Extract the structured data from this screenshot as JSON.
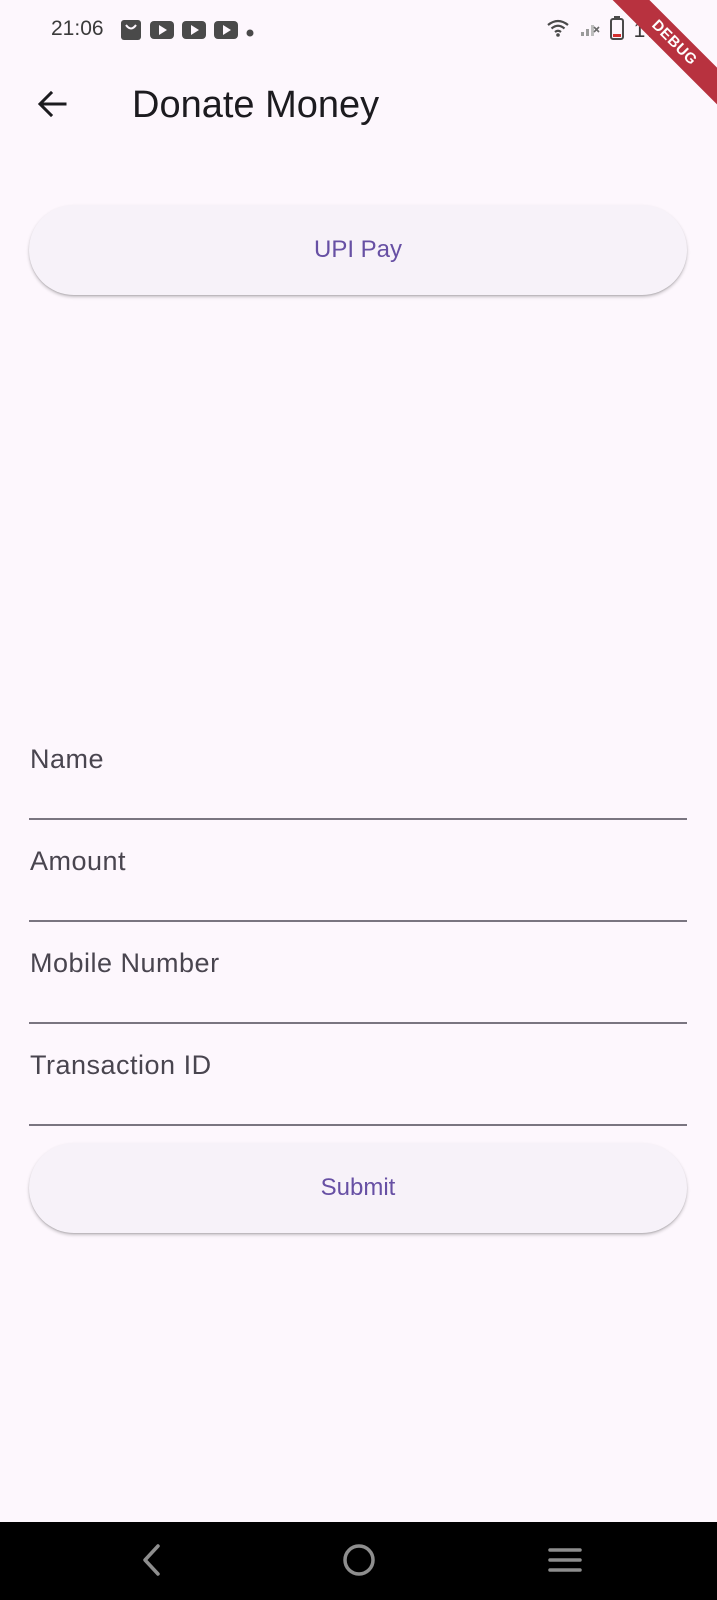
{
  "status_bar": {
    "time": "21:06",
    "battery_level": "17",
    "icons": [
      "shopping-bag-icon",
      "youtube-icon",
      "youtube-icon",
      "youtube-icon",
      "dot-icon",
      "wifi-icon",
      "signal-icon",
      "battery-icon"
    ]
  },
  "debug_banner": {
    "label": "DEBUG"
  },
  "app_bar": {
    "title": "Donate Money",
    "back_icon": "arrow-back-icon"
  },
  "upi_button": {
    "label": "UPI Pay"
  },
  "form": {
    "name": {
      "label": "Name",
      "value": ""
    },
    "amount": {
      "label": "Amount",
      "value": ""
    },
    "mobile": {
      "label": "Mobile Number",
      "value": ""
    },
    "transaction_id": {
      "label": "Transaction ID",
      "value": ""
    }
  },
  "submit_button": {
    "label": "Submit"
  },
  "nav_bar": {
    "back_icon": "nav-back-icon",
    "home_icon": "nav-home-icon",
    "recents_icon": "nav-menu-icon"
  },
  "colors": {
    "background": "#fdf7fd",
    "button_bg": "#f7f2f9",
    "accent": "#6750a4",
    "debug": "#b8323f"
  }
}
